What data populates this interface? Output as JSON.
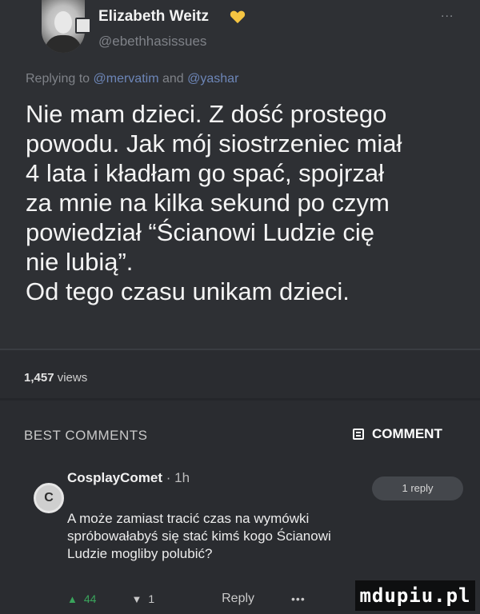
{
  "post": {
    "author_name": "Elizabeth Weitz",
    "handle": "@ebethhasissues",
    "reply_prefix": "Replying to ",
    "reply_mention_1": "@mervatim",
    "reply_and": " and ",
    "reply_mention_2": "@yashar",
    "more": "...",
    "text": {
      "line1": "Nie mam dzieci. Z dość prostego",
      "line2": "powodu. Jak mój siostrzeniec miał",
      "line3": "4 lata i kładłam go spać, spojrzał",
      "line4": "za mnie na kilka sekund po czym",
      "line5": "powiedział “Ścianowi Ludzie cię",
      "line6": "nie lubią”.",
      "line7": "Od tego czasu unikam dzieci."
    },
    "views_count": "1,457",
    "views_label": "views"
  },
  "comments_section": {
    "heading": "BEST COMMENTS",
    "comment_button": "COMMENT"
  },
  "comment": {
    "avatar_letter": "C",
    "author": "CosplayComet",
    "time": " · 1h",
    "reply_count": "1 reply",
    "text": {
      "line1": "A może zamiast tracić czas na wymówki",
      "line2": "spróbowałabyś się stać kimś kogo Ścianowi",
      "line3": "Ludzie mogliby polubić?"
    },
    "upvotes": "44",
    "downvotes": "1",
    "reply_label": "Reply",
    "more": "•••"
  },
  "watermark": "mdupiu.pl",
  "colors": {
    "background": "#2a2c30",
    "mention": "#6d86b8",
    "upvote": "#3aa55c",
    "heart": "#f5c542"
  },
  "icons": {
    "heart": "yellow-heart-icon",
    "comment": "comment-icon",
    "upvote": "arrow-up-icon",
    "downvote": "arrow-down-icon"
  }
}
